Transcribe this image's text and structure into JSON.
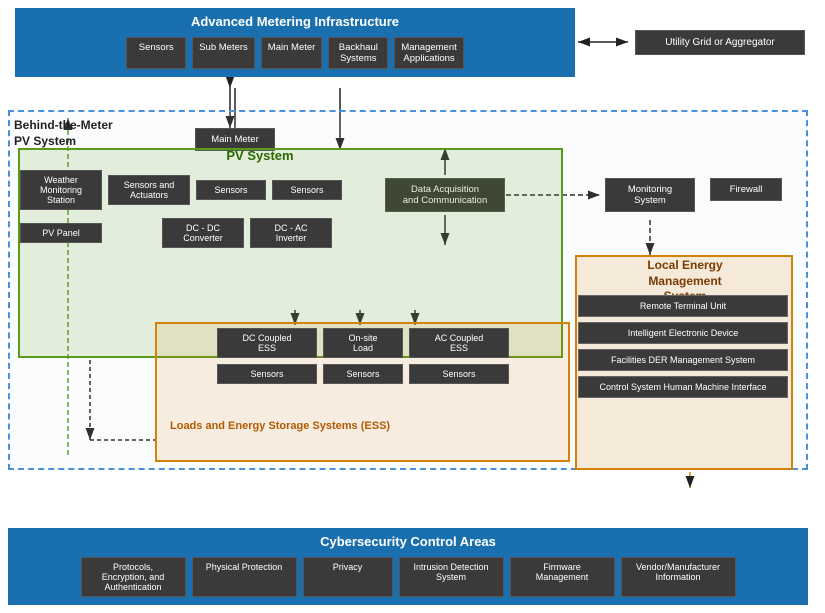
{
  "ami": {
    "title": "Advanced Metering Infrastructure",
    "boxes": [
      "Sensors",
      "Sub Meters",
      "Main Meter",
      "Backhaul Systems",
      "Management Applications"
    ]
  },
  "utility": {
    "label": "Utility Grid or Aggregator"
  },
  "btm": {
    "label": "Behind-the-Meter\nPV System"
  },
  "main_meter": {
    "label": "Main Meter"
  },
  "data_acq": {
    "label": "Data Acquisition\nand Communication"
  },
  "monitoring": {
    "label": "Monitoring\nSystem"
  },
  "firewall": {
    "label": "Firewall"
  },
  "pv_system": {
    "title": "PV System",
    "row1": [
      "Weather\nMonitoring\nStation",
      "Sensors and\nActuators",
      "Sensors",
      "Sensors"
    ],
    "row2": [
      "PV Panel",
      "DC - DC\nConverter",
      "DC - AC\nInverter"
    ]
  },
  "ess": {
    "title": "Loads and Energy Storage Systems (ESS)",
    "row1": [
      "DC Coupled\nESS",
      "On-site\nLoad",
      "AC Coupled\nESS"
    ],
    "row2_labels": [
      "Sensors",
      "Sensors",
      "Sensors"
    ]
  },
  "lems": {
    "title": "Local Energy\nManagement\nSystem",
    "boxes": [
      "Remote Terminal Unit",
      "Intelligent Electronic Device",
      "Facilities DER Management System",
      "Control System Human Machine Interface"
    ]
  },
  "cybersecurity": {
    "title": "Cybersecurity Control Areas",
    "boxes": [
      "Protocols,\nEncryption, and\nAuthentication",
      "Physical Protection",
      "Privacy",
      "Intrusion Detection\nSystem",
      "Firmware\nManagement",
      "Vendor/Manufacturer\nInformation"
    ]
  }
}
